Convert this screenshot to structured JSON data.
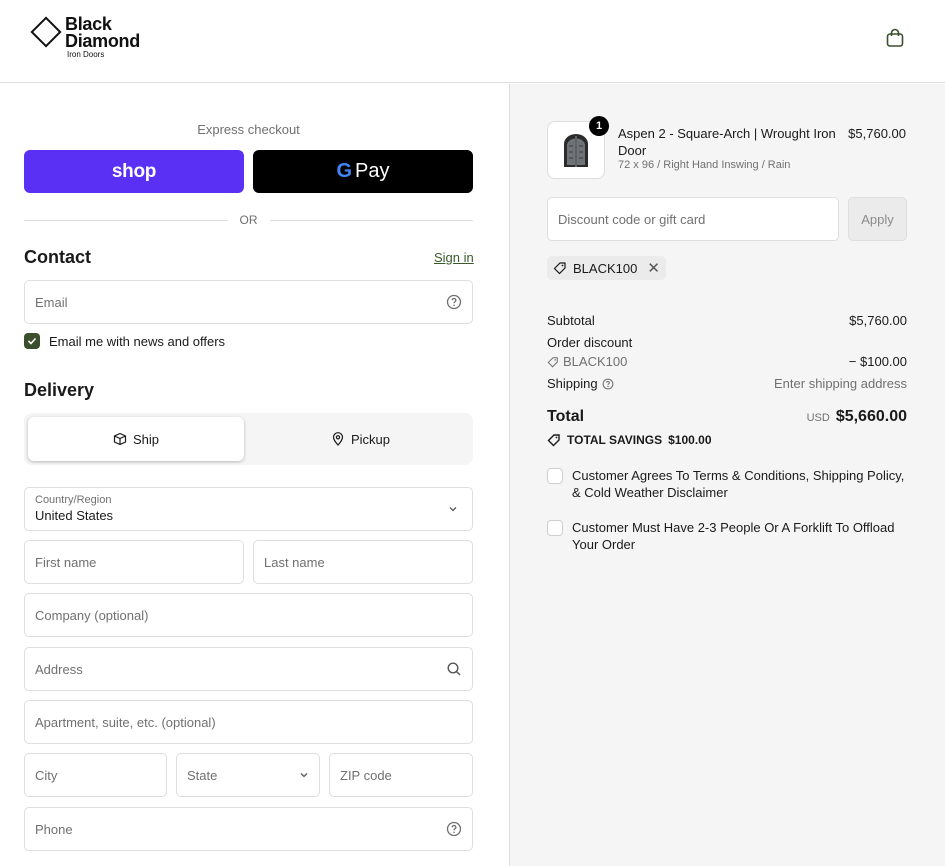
{
  "brand": {
    "line1": "Black",
    "line2": "Diamond",
    "line3": "Iron Doors"
  },
  "express": {
    "label": "Express checkout",
    "shop_label": "shop",
    "gpay_g": "G",
    "gpay_label": "Pay",
    "or_label": "OR"
  },
  "contact": {
    "title": "Contact",
    "signin": "Sign in",
    "email_placeholder": "Email",
    "newsletter_label": "Email me with news and offers"
  },
  "delivery": {
    "title": "Delivery",
    "ship_label": "Ship",
    "pickup_label": "Pickup",
    "country_label": "Country/Region",
    "country_value": "United States",
    "first_name": "First name",
    "last_name": "Last name",
    "company": "Company (optional)",
    "address": "Address",
    "apartment": "Apartment, suite, etc. (optional)",
    "city": "City",
    "state": "State",
    "zip": "ZIP code",
    "phone": "Phone"
  },
  "order": {
    "quantity": "1",
    "product_name": "Aspen 2 - Square-Arch | Wrought Iron Door",
    "product_variant": "72 x 96 / Right Hand Inswing / Rain",
    "product_price": "$5,760.00",
    "discount_placeholder": "Discount code or gift card",
    "apply_label": "Apply",
    "applied_code": "BLACK100",
    "subtotal_label": "Subtotal",
    "subtotal_value": "$5,760.00",
    "order_discount_label": "Order discount",
    "discount_code": "BLACK100",
    "discount_value": "− $100.00",
    "shipping_label": "Shipping",
    "shipping_value": "Enter shipping address",
    "total_label": "Total",
    "total_currency": "USD",
    "total_value": "$5,660.00",
    "savings_label": "TOTAL SAVINGS",
    "savings_value": "$100.00",
    "agree_terms": "Customer Agrees To Terms & Conditions, Shipping Policy, & Cold Weather Disclaimer",
    "agree_forklift": "Customer Must Have 2-3 People Or A Forklift To Offload Your Order"
  },
  "colors": {
    "shop_purple": "#5a31f4",
    "gpay_black": "#000000",
    "accent_green": "#3c4f2c"
  }
}
